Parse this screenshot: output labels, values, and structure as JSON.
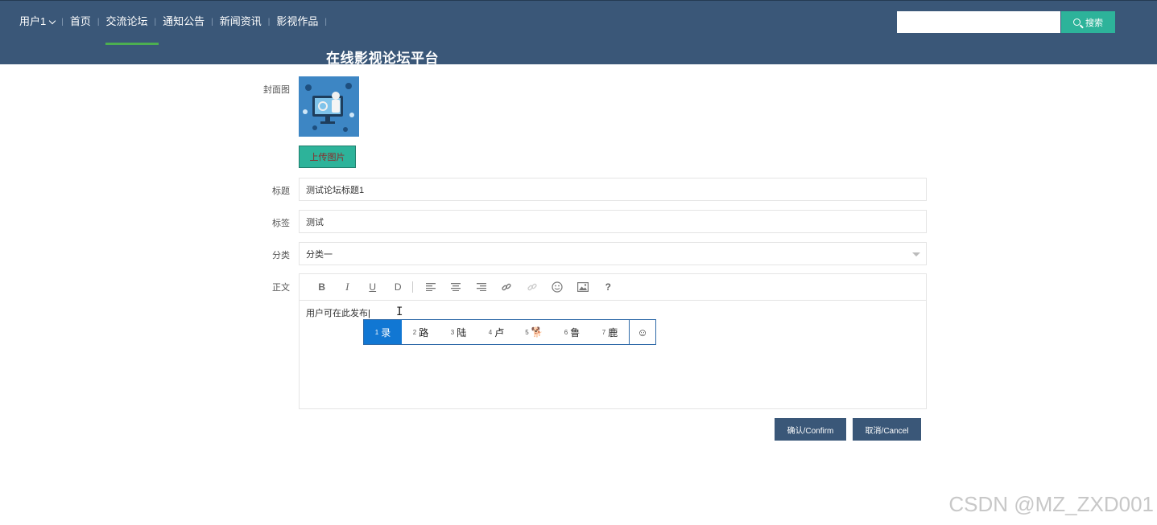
{
  "header": {
    "user_menu": "用户1",
    "nav": [
      "首页",
      "交流论坛",
      "通知公告",
      "新闻资讯",
      "影视作品"
    ],
    "site_title": "在线影视论坛平台",
    "search": {
      "value": "",
      "button_label": "搜索"
    },
    "colors": {
      "background": "#3a5778",
      "active_underline": "#4caf50",
      "search_button": "#2db39a"
    }
  },
  "form": {
    "cover": {
      "label": "封面图",
      "upload_label": "上传图片"
    },
    "title": {
      "label": "标题",
      "value": "测试论坛标题1"
    },
    "tags": {
      "label": "标签",
      "value": "测试"
    },
    "category": {
      "label": "分类",
      "value": "分类一"
    },
    "body": {
      "label": "正文",
      "toolbar": [
        "B",
        "I",
        "U",
        "D",
        "align-left-icon",
        "align-center-icon",
        "align-right-icon",
        "link-icon",
        "unlink-icon",
        "emoji-icon",
        "image-icon",
        "?"
      ],
      "content": "用户可在此发布"
    },
    "ime": {
      "candidates": [
        {
          "num": "1",
          "char": "录"
        },
        {
          "num": "2",
          "char": "路"
        },
        {
          "num": "3",
          "char": "陆"
        },
        {
          "num": "4",
          "char": "卢"
        },
        {
          "num": "5",
          "char": "🐕"
        },
        {
          "num": "6",
          "char": "鲁"
        },
        {
          "num": "7",
          "char": "鹿"
        }
      ],
      "emoji_button": "☺"
    },
    "buttons": {
      "confirm": "确认/Confirm",
      "cancel": "取消/Cancel"
    }
  },
  "watermark": "CSDN @MZ_ZXD001"
}
